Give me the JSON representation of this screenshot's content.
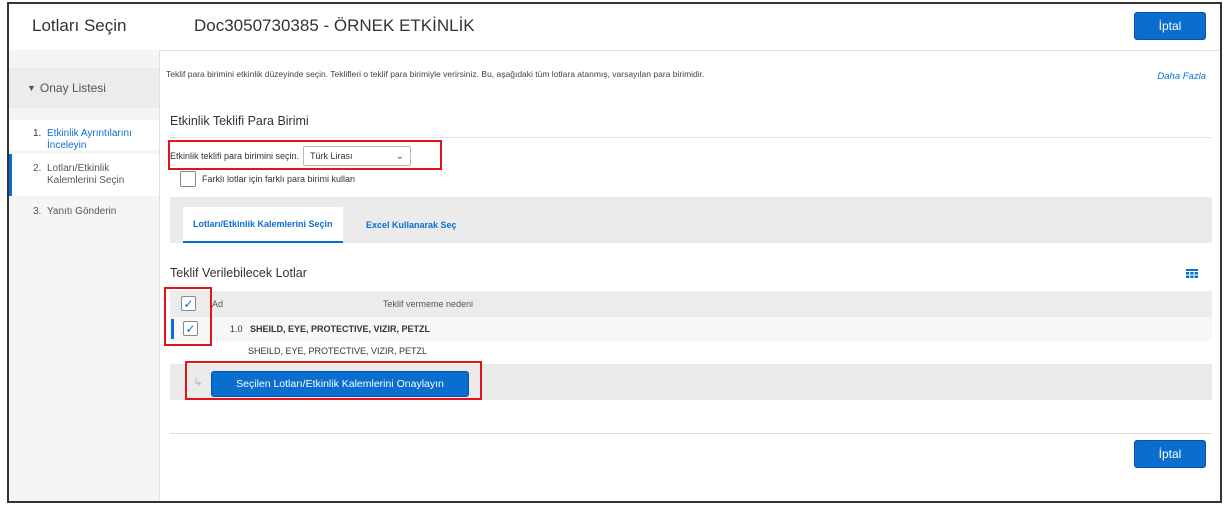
{
  "header": {
    "app_title": "Lotları Seçin",
    "doc_title": "Doc3050730385 - ÖRNEK ETKİNLİK",
    "cancel_label": "İptal"
  },
  "sidebar": {
    "list_title": "Onay Listesi",
    "steps": [
      {
        "num": "1.",
        "label": "Etkinlik Ayrıntılarını İnceleyin"
      },
      {
        "num": "2.",
        "label": "Lotları/Etkinlik Kalemlerini Seçin"
      },
      {
        "num": "3.",
        "label": "Yanıtı Gönderin"
      }
    ]
  },
  "main": {
    "intro_text": "Teklif para birimini etkinlik düzeyinde seçin. Teklifleri o teklif para birimiyle verirsiniz. Bu, aşağıdaki tüm lotlara atanmış, varsayılan para birimidir.",
    "more_link": "Daha Fazla",
    "currency_section_title": "Etkinlik Teklifi Para Birimi",
    "currency_label": "Etkinlik teklifi para birimini seçin.",
    "currency_value": "Türk Lirası",
    "multi_currency_label": "Farklı lotlar için farklı para birimi kullan",
    "tabs": [
      {
        "label": "Lotları/Etkinlik Kalemlerini Seçin"
      },
      {
        "label": "Excel Kullanarak Seç"
      }
    ],
    "lots_section_title": "Teklif Verilebilecek Lotlar",
    "table": {
      "col_name": "Ad",
      "col_reason": "Teklif vermeme nedeni",
      "rows": [
        {
          "num": "1.0",
          "name": "SHEILD, EYE, PROTECTIVE, VIZIR, PETZL",
          "description": "SHEILD, EYE, PROTECTIVE, VIZIR, PETZL",
          "checked": true
        }
      ]
    },
    "confirm_button": "Seçilen Lotları/Etkinlik Kalemlerini Onaylayın",
    "cancel_label": "İptal"
  },
  "icons": {
    "checkmark": "✓",
    "triangle": "▼",
    "chevron": "chevron-down-icon",
    "arrow": "return-arrow-icon",
    "grid": "table-settings-icon"
  },
  "colors": {
    "accent": "#0a6ed1",
    "highlight": "#e0141a"
  }
}
